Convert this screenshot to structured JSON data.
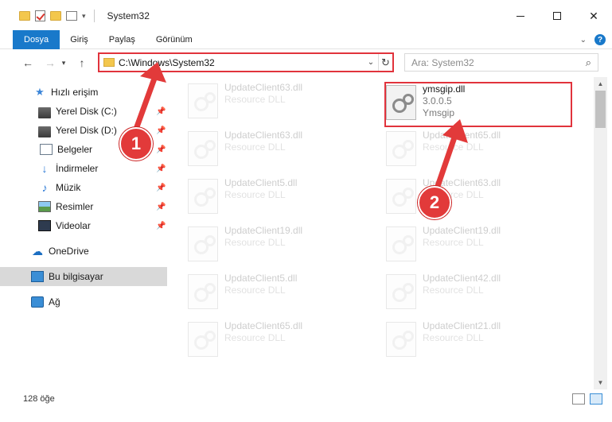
{
  "window": {
    "title": "System32",
    "controls": {
      "minimize": "—",
      "maximize": "□",
      "close": "✕"
    }
  },
  "ribbon": {
    "tabs": [
      "Dosya",
      "Giriş",
      "Paylaş",
      "Görünüm"
    ],
    "help": "?"
  },
  "address": {
    "path": "C:\\Windows\\System32",
    "search_placeholder": "Ara: System32"
  },
  "sidebar": {
    "items": [
      {
        "label": "Hızlı erişim",
        "icon": "star-icon"
      },
      {
        "label": "Yerel Disk (C:)",
        "icon": "disk-icon",
        "pinned": true
      },
      {
        "label": "Yerel Disk (D:)",
        "icon": "disk-icon",
        "pinned": true
      },
      {
        "label": "Belgeler",
        "icon": "document-icon",
        "pinned": true
      },
      {
        "label": "İndirmeler",
        "icon": "download-icon",
        "pinned": true
      },
      {
        "label": "Müzik",
        "icon": "music-icon",
        "pinned": true
      },
      {
        "label": "Resimler",
        "icon": "pictures-icon",
        "pinned": true
      },
      {
        "label": "Videolar",
        "icon": "video-icon",
        "pinned": true
      },
      {
        "label": "OneDrive",
        "icon": "cloud-icon"
      },
      {
        "label": "Bu bilgisayar",
        "icon": "computer-icon",
        "selected": true
      },
      {
        "label": "Ağ",
        "icon": "network-icon"
      }
    ]
  },
  "files": {
    "highlighted": {
      "name": "ymsgip.dll",
      "version": "3.0.0.5",
      "company": "Ymsgip"
    },
    "faded_left": [
      {
        "name": "UpdateClient63.dll",
        "type": "Resource DLL"
      },
      {
        "name": "UpdateClient63.dll",
        "type": "Resource DLL"
      },
      {
        "name": "UpdateClient5.dll",
        "type": "Resource DLL"
      },
      {
        "name": "UpdateClient19.dll",
        "type": "Resource DLL"
      },
      {
        "name": "UpdateClient5.dll",
        "type": "Resource DLL"
      },
      {
        "name": "UpdateClient65.dll",
        "type": "Resource DLL"
      }
    ],
    "faded_right": [
      {
        "name": "UpdateClient65.dll",
        "type": "Resource DLL"
      },
      {
        "name": "UpdateClient63.dll",
        "type": "Resource DLL"
      },
      {
        "name": "UpdateClient19.dll",
        "type": "Resource DLL"
      },
      {
        "name": "UpdateClient42.dll",
        "type": "Resource DLL"
      },
      {
        "name": "UpdateClient21.dll",
        "type": "Resource DLL"
      }
    ]
  },
  "status": {
    "item_count": "128 öğe"
  },
  "annotations": {
    "step1": "1",
    "step2": "2",
    "color": "#e23a3a"
  }
}
